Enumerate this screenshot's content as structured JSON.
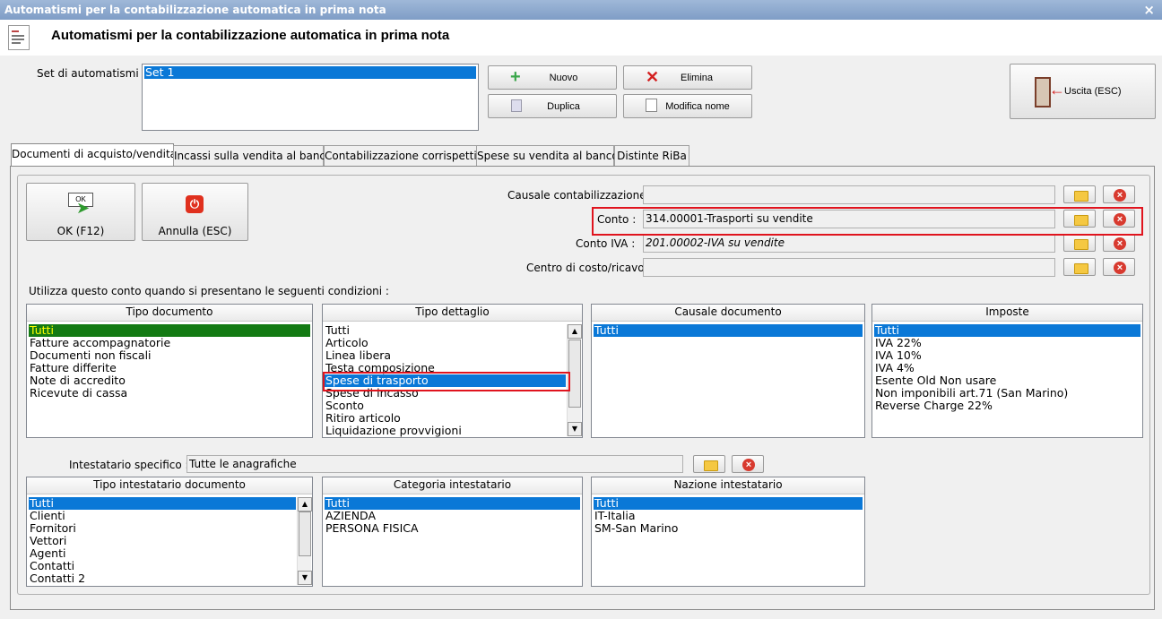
{
  "window": {
    "title": "Automatismi per la contabilizzazione automatica in prima nota",
    "close_glyph": "×"
  },
  "header": {
    "title": "Automatismi per la contabilizzazione automatica in prima nota"
  },
  "set": {
    "label": "Set di automatismi :",
    "items": [
      "Set 1"
    ]
  },
  "toolbar": {
    "nuovo": "Nuovo",
    "elimina": "Elimina",
    "duplica": "Duplica",
    "modifica": "Modifica nome",
    "uscita": "Uscita (ESC)"
  },
  "tabs": [
    "Documenti di acquisto/vendita",
    "Incassi sulla vendita al banco",
    "Contabilizzazione corrispettivi",
    "Spese su vendita al banco",
    "Distinte RiBa"
  ],
  "actions": {
    "ok": "OK (F12)",
    "ok_icon_text": "OK",
    "annulla": "Annulla (ESC)"
  },
  "fields": {
    "causale": {
      "label": "Causale contabilizzazione :",
      "value": ""
    },
    "conto": {
      "label": "Conto :",
      "value": "314.00001-Trasporti su vendite"
    },
    "conto_iva": {
      "label": "Conto IVA :",
      "value": "201.00002-IVA su vendite"
    },
    "centro": {
      "label": "Centro di costo/ricavo",
      "value": ""
    }
  },
  "conditions_label": "Utilizza questo conto quando si presentano le seguenti condizioni :",
  "tipo_documento": {
    "header": "Tipo documento",
    "items": [
      "Tutti",
      "Fatture accompagnatorie",
      "Documenti non fiscali",
      "Fatture differite",
      "Note di accredito",
      "Ricevute di cassa"
    ]
  },
  "tipo_dettaglio": {
    "header": "Tipo dettaglio",
    "items": [
      "Tutti",
      "Articolo",
      "Linea libera",
      "Testa composizione",
      "Spese di trasporto",
      "Spese di incasso",
      "Sconto",
      "Ritiro articolo",
      "Liquidazione provvigioni"
    ]
  },
  "causale_documento": {
    "header": "Causale documento",
    "items": [
      "Tutti"
    ]
  },
  "imposte": {
    "header": "Imposte",
    "items": [
      "Tutti",
      "IVA 22%",
      "IVA 10%",
      "IVA 4%",
      "Esente Old Non usare",
      "Non imponibili art.71 (San Marino)",
      "Reverse Charge 22%"
    ]
  },
  "intestatario": {
    "label": "Intestatario specifico :",
    "value": "Tutte le anagrafiche"
  },
  "tipo_intestatario": {
    "header": "Tipo intestatario documento",
    "items": [
      "Tutti",
      "Clienti",
      "Fornitori",
      "Vettori",
      "Agenti",
      "Contatti",
      "Contatti 2"
    ]
  },
  "categoria_intestatario": {
    "header": "Categoria intestatario",
    "items": [
      "Tutti",
      "AZIENDA",
      "PERSONA FISICA"
    ]
  },
  "nazione_intestatario": {
    "header": "Nazione intestatario",
    "items": [
      "Tutti",
      "IT-Italia",
      "SM-San Marino"
    ]
  },
  "scroll": {
    "up": "▲",
    "down": "▼"
  },
  "colors": {
    "selection": "#0a78d7",
    "tipo_documento_selection": "#137a13",
    "highlight": "#e0141e"
  }
}
